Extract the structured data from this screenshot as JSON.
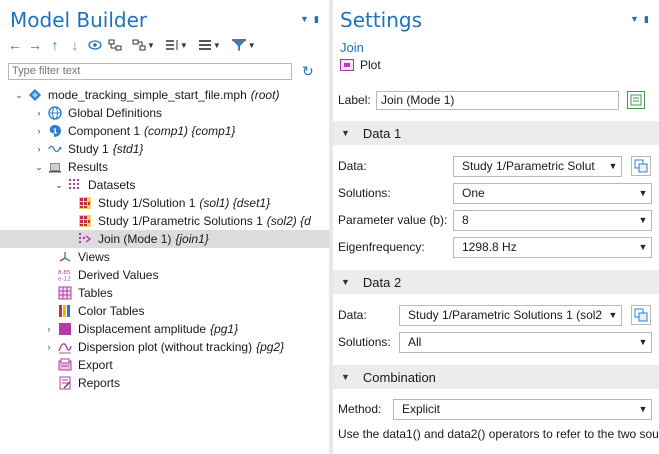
{
  "model_builder": {
    "title": "Model Builder",
    "filter_placeholder": "Type filter text",
    "tree": [
      {
        "text": "mode_tracking_simple_start_file.mph",
        "tag": "(root)"
      },
      {
        "text": "Global Definitions",
        "tag": ""
      },
      {
        "text": "Component 1",
        "tag": "(comp1) {comp1}"
      },
      {
        "text": "Study 1",
        "tag": "{std1}"
      },
      {
        "text": "Results",
        "tag": ""
      },
      {
        "text": "Datasets",
        "tag": ""
      },
      {
        "text": "Study 1/Solution 1",
        "tag": "(sol1) {dset1}"
      },
      {
        "text": "Study 1/Parametric Solutions 1",
        "tag": "(sol2) {d"
      },
      {
        "text": "Join (Mode 1)",
        "tag": "{join1}"
      },
      {
        "text": "Views",
        "tag": ""
      },
      {
        "text": "Derived Values",
        "tag": ""
      },
      {
        "text": "Tables",
        "tag": ""
      },
      {
        "text": "Color Tables",
        "tag": ""
      },
      {
        "text": "Displacement amplitude",
        "tag": "{pg1}"
      },
      {
        "text": "Dispersion plot (without tracking)",
        "tag": "{pg2}"
      },
      {
        "text": "Export",
        "tag": ""
      },
      {
        "text": "Reports",
        "tag": ""
      }
    ]
  },
  "settings": {
    "title": "Settings",
    "subtitle": "Join",
    "type_label": "Plot",
    "label_field": {
      "label": "Label:",
      "value": "Join (Mode 1)"
    },
    "data1": {
      "header": "Data 1",
      "rows": [
        {
          "label": "Data:",
          "value": "Study 1/Parametric Solut"
        },
        {
          "label": "Solutions:",
          "value": "One"
        },
        {
          "label": "Parameter value (b):",
          "value": "8"
        },
        {
          "label": "Eigenfrequency:",
          "value": "1298.8 Hz"
        }
      ]
    },
    "data2": {
      "header": "Data 2",
      "rows": [
        {
          "label": "Data:",
          "value": "Study 1/Parametric Solutions 1 (sol2"
        },
        {
          "label": "Solutions:",
          "value": "All"
        }
      ]
    },
    "combination": {
      "header": "Combination",
      "method_label": "Method:",
      "method_value": "Explicit",
      "description": "Use the data1() and data2() operators to refer to the two sour"
    }
  },
  "colors": {
    "accent": "#1e73be",
    "selected_row": "#dcdcdc",
    "section_bg": "#ececec"
  }
}
